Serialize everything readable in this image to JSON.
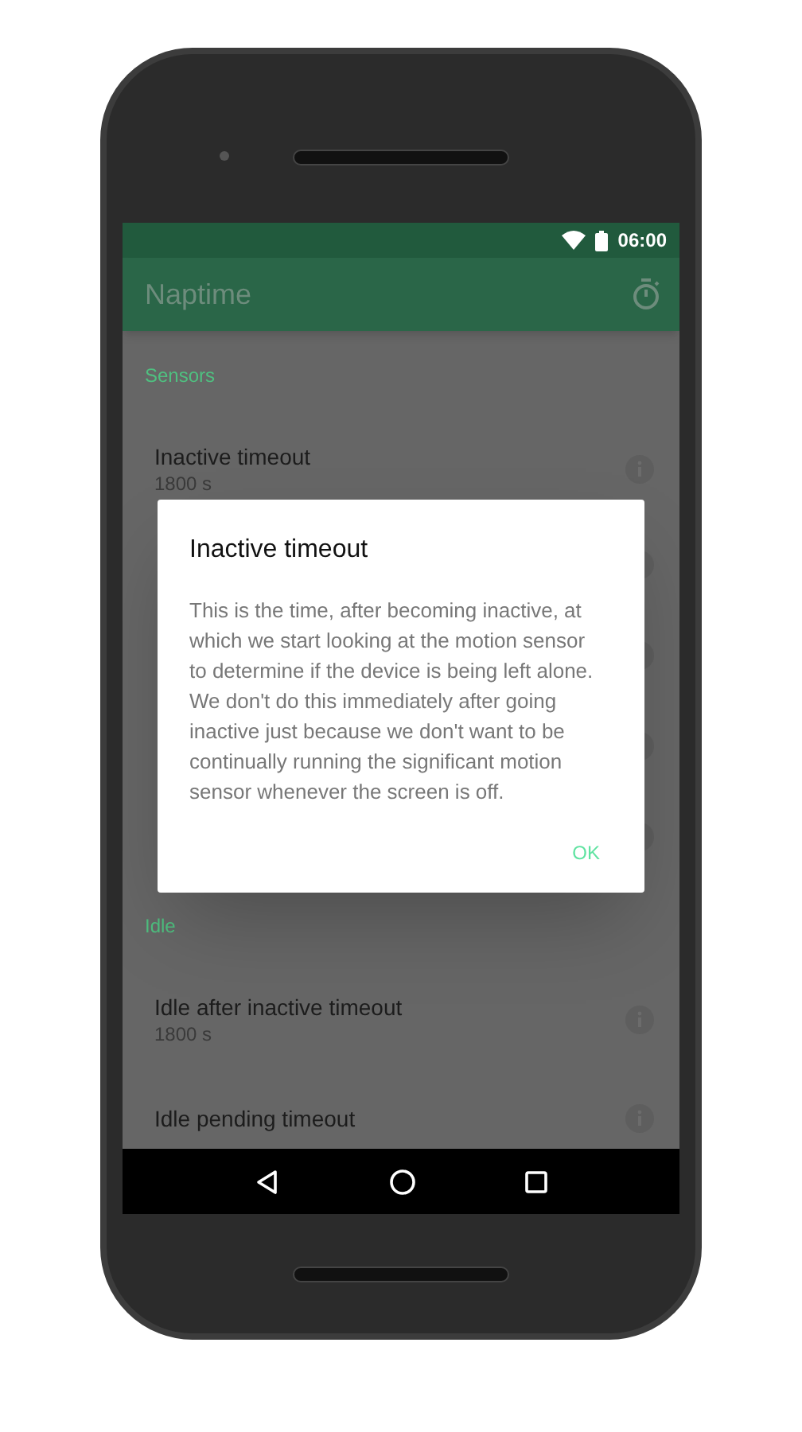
{
  "status_bar": {
    "time": "06:00"
  },
  "toolbar": {
    "title": "Naptime"
  },
  "sections": [
    {
      "header": "Sensors",
      "items": [
        {
          "title": "Inactive timeout",
          "value": "1800 s"
        }
      ]
    },
    {
      "header": "Idle",
      "items": [
        {
          "title": "Idle after inactive timeout",
          "value": "1800 s"
        },
        {
          "title": "Idle pending timeout"
        }
      ]
    }
  ],
  "dialog": {
    "title": "Inactive timeout",
    "message": "This is the time, after becoming inactive, at which we start looking at the motion sensor to determine if the device is being left alone. We don't do this immediately after going inactive just because we don't want to be continually running the significant motion sensor whenever the screen is off.",
    "button": "OK"
  }
}
